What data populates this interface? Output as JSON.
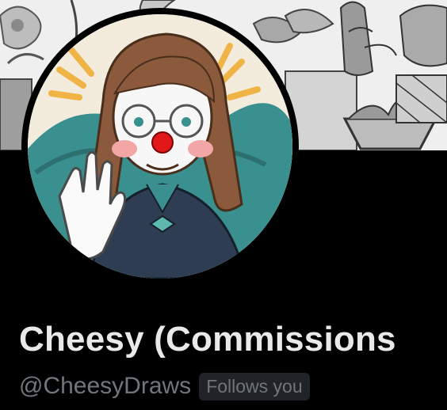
{
  "profile": {
    "display_name": "Cheesy (Commissions",
    "handle": "@CheesyDraws",
    "follows_you_badge": "Follows you"
  },
  "banner": {
    "image": "potted-plants-sketch-banner"
  },
  "avatar": {
    "image": "clown-character-waving-avatar"
  },
  "colors": {
    "background": "#000000",
    "primary_text": "#e7e9ea",
    "secondary_text": "#71767b",
    "badge_background": "#202327"
  }
}
